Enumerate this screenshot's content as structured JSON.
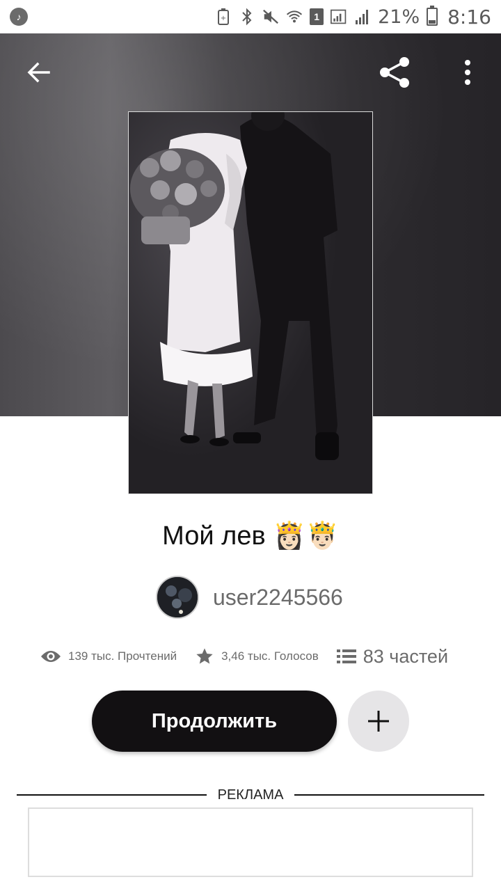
{
  "status_bar": {
    "battery_percent": "21%",
    "time": "8:16",
    "sim_number": "1",
    "icons": [
      "music-note-icon",
      "battery-saver-icon",
      "bluetooth-icon",
      "mute-icon",
      "wifi-icon",
      "signal-icon",
      "signal-icon-2",
      "battery-icon"
    ]
  },
  "toolbar": {
    "icons": [
      "back-arrow-icon",
      "share-icon",
      "more-vertical-icon"
    ]
  },
  "story": {
    "title": "Мой лев 👸🏻🤴🏻",
    "author": "user2245566",
    "reads": "139 тыс. Прочтений",
    "votes": "3,46 тыс. Голосов",
    "parts": "83 частей"
  },
  "actions": {
    "continue_label": "Продолжить",
    "add_icon": "plus-icon"
  },
  "ad": {
    "label": "РЕКЛАМА"
  },
  "colors": {
    "primary_button": "#121012",
    "secondary_button": "#e6e5e7",
    "muted_text": "#6b6b6b"
  }
}
